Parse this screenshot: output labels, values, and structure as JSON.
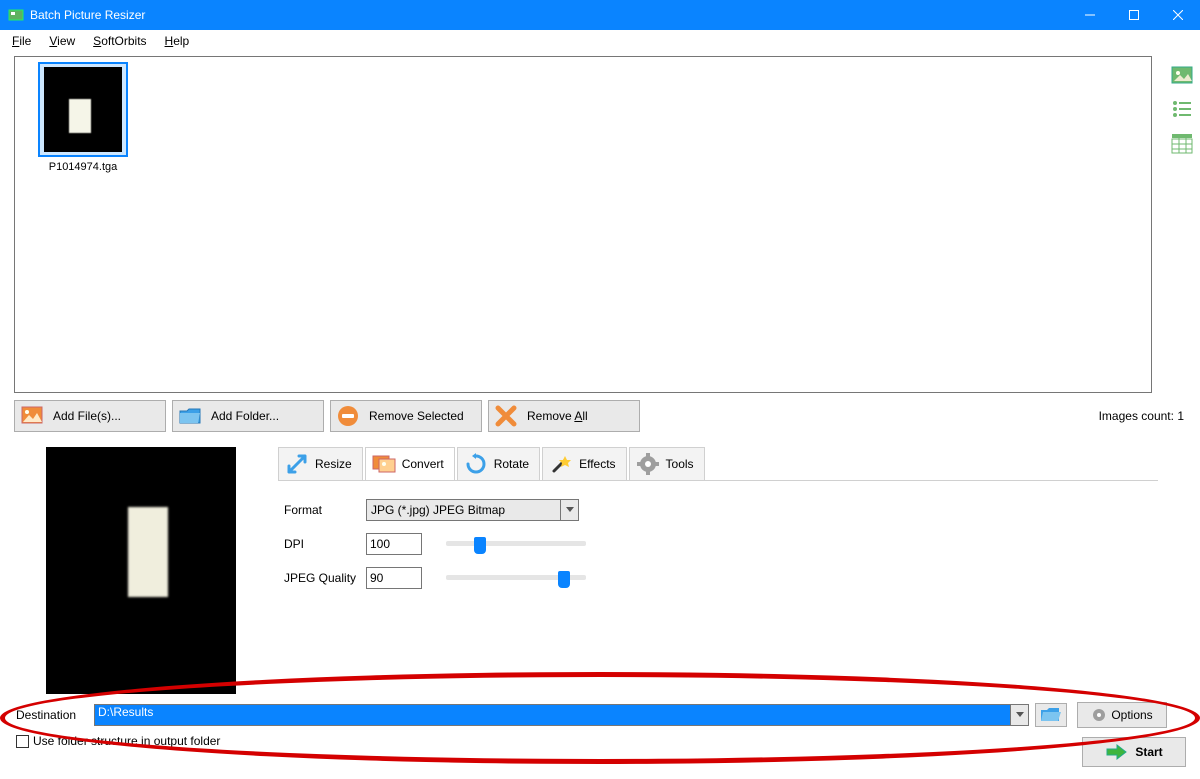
{
  "app": {
    "title": "Batch Picture Resizer"
  },
  "menu": {
    "file": "File",
    "view": "View",
    "softorbits": "SoftOrbits",
    "help": "Help"
  },
  "thumb": {
    "name": "P1014974.tga"
  },
  "toolbar": {
    "add_files": "Add File(s)...",
    "add_folder": "Add Folder...",
    "remove_selected": "Remove Selected",
    "remove_all": "Remove All"
  },
  "status": {
    "images_count_label": "Images count: ",
    "images_count": "1"
  },
  "tabs": {
    "resize": "Resize",
    "convert": "Convert",
    "rotate": "Rotate",
    "effects": "Effects",
    "tools": "Tools"
  },
  "convert": {
    "format_label": "Format",
    "format_value": "JPG (*.jpg) JPEG Bitmap",
    "dpi_label": "DPI",
    "dpi_value": "100",
    "quality_label": "JPEG Quality",
    "quality_value": "90"
  },
  "dest": {
    "label": "Destination",
    "value": "D:\\Results"
  },
  "options": {
    "use_folder_structure": "Use folder structure in output folder",
    "options_btn": "Options"
  },
  "start": {
    "label": "Start"
  }
}
